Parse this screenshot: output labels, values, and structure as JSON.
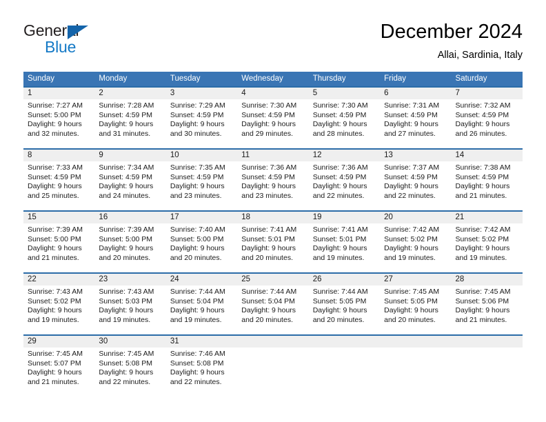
{
  "brand": {
    "name_part1": "General",
    "name_part2": "Blue",
    "accent_color": "#1479c6",
    "triangle_color": "#1464aa"
  },
  "header": {
    "title": "December 2024",
    "subtitle": "Allai, Sardinia, Italy"
  },
  "theme": {
    "header_blue": "#3a75b4",
    "rule_blue": "#2b6ca8",
    "daynum_band": "#efefef"
  },
  "weekdays": [
    "Sunday",
    "Monday",
    "Tuesday",
    "Wednesday",
    "Thursday",
    "Friday",
    "Saturday"
  ],
  "weeks": [
    [
      {
        "day": "1",
        "sunrise": "Sunrise: 7:27 AM",
        "sunset": "Sunset: 5:00 PM",
        "daylight1": "Daylight: 9 hours",
        "daylight2": "and 32 minutes."
      },
      {
        "day": "2",
        "sunrise": "Sunrise: 7:28 AM",
        "sunset": "Sunset: 4:59 PM",
        "daylight1": "Daylight: 9 hours",
        "daylight2": "and 31 minutes."
      },
      {
        "day": "3",
        "sunrise": "Sunrise: 7:29 AM",
        "sunset": "Sunset: 4:59 PM",
        "daylight1": "Daylight: 9 hours",
        "daylight2": "and 30 minutes."
      },
      {
        "day": "4",
        "sunrise": "Sunrise: 7:30 AM",
        "sunset": "Sunset: 4:59 PM",
        "daylight1": "Daylight: 9 hours",
        "daylight2": "and 29 minutes."
      },
      {
        "day": "5",
        "sunrise": "Sunrise: 7:30 AM",
        "sunset": "Sunset: 4:59 PM",
        "daylight1": "Daylight: 9 hours",
        "daylight2": "and 28 minutes."
      },
      {
        "day": "6",
        "sunrise": "Sunrise: 7:31 AM",
        "sunset": "Sunset: 4:59 PM",
        "daylight1": "Daylight: 9 hours",
        "daylight2": "and 27 minutes."
      },
      {
        "day": "7",
        "sunrise": "Sunrise: 7:32 AM",
        "sunset": "Sunset: 4:59 PM",
        "daylight1": "Daylight: 9 hours",
        "daylight2": "and 26 minutes."
      }
    ],
    [
      {
        "day": "8",
        "sunrise": "Sunrise: 7:33 AM",
        "sunset": "Sunset: 4:59 PM",
        "daylight1": "Daylight: 9 hours",
        "daylight2": "and 25 minutes."
      },
      {
        "day": "9",
        "sunrise": "Sunrise: 7:34 AM",
        "sunset": "Sunset: 4:59 PM",
        "daylight1": "Daylight: 9 hours",
        "daylight2": "and 24 minutes."
      },
      {
        "day": "10",
        "sunrise": "Sunrise: 7:35 AM",
        "sunset": "Sunset: 4:59 PM",
        "daylight1": "Daylight: 9 hours",
        "daylight2": "and 23 minutes."
      },
      {
        "day": "11",
        "sunrise": "Sunrise: 7:36 AM",
        "sunset": "Sunset: 4:59 PM",
        "daylight1": "Daylight: 9 hours",
        "daylight2": "and 23 minutes."
      },
      {
        "day": "12",
        "sunrise": "Sunrise: 7:36 AM",
        "sunset": "Sunset: 4:59 PM",
        "daylight1": "Daylight: 9 hours",
        "daylight2": "and 22 minutes."
      },
      {
        "day": "13",
        "sunrise": "Sunrise: 7:37 AM",
        "sunset": "Sunset: 4:59 PM",
        "daylight1": "Daylight: 9 hours",
        "daylight2": "and 22 minutes."
      },
      {
        "day": "14",
        "sunrise": "Sunrise: 7:38 AM",
        "sunset": "Sunset: 4:59 PM",
        "daylight1": "Daylight: 9 hours",
        "daylight2": "and 21 minutes."
      }
    ],
    [
      {
        "day": "15",
        "sunrise": "Sunrise: 7:39 AM",
        "sunset": "Sunset: 5:00 PM",
        "daylight1": "Daylight: 9 hours",
        "daylight2": "and 21 minutes."
      },
      {
        "day": "16",
        "sunrise": "Sunrise: 7:39 AM",
        "sunset": "Sunset: 5:00 PM",
        "daylight1": "Daylight: 9 hours",
        "daylight2": "and 20 minutes."
      },
      {
        "day": "17",
        "sunrise": "Sunrise: 7:40 AM",
        "sunset": "Sunset: 5:00 PM",
        "daylight1": "Daylight: 9 hours",
        "daylight2": "and 20 minutes."
      },
      {
        "day": "18",
        "sunrise": "Sunrise: 7:41 AM",
        "sunset": "Sunset: 5:01 PM",
        "daylight1": "Daylight: 9 hours",
        "daylight2": "and 20 minutes."
      },
      {
        "day": "19",
        "sunrise": "Sunrise: 7:41 AM",
        "sunset": "Sunset: 5:01 PM",
        "daylight1": "Daylight: 9 hours",
        "daylight2": "and 19 minutes."
      },
      {
        "day": "20",
        "sunrise": "Sunrise: 7:42 AM",
        "sunset": "Sunset: 5:02 PM",
        "daylight1": "Daylight: 9 hours",
        "daylight2": "and 19 minutes."
      },
      {
        "day": "21",
        "sunrise": "Sunrise: 7:42 AM",
        "sunset": "Sunset: 5:02 PM",
        "daylight1": "Daylight: 9 hours",
        "daylight2": "and 19 minutes."
      }
    ],
    [
      {
        "day": "22",
        "sunrise": "Sunrise: 7:43 AM",
        "sunset": "Sunset: 5:02 PM",
        "daylight1": "Daylight: 9 hours",
        "daylight2": "and 19 minutes."
      },
      {
        "day": "23",
        "sunrise": "Sunrise: 7:43 AM",
        "sunset": "Sunset: 5:03 PM",
        "daylight1": "Daylight: 9 hours",
        "daylight2": "and 19 minutes."
      },
      {
        "day": "24",
        "sunrise": "Sunrise: 7:44 AM",
        "sunset": "Sunset: 5:04 PM",
        "daylight1": "Daylight: 9 hours",
        "daylight2": "and 19 minutes."
      },
      {
        "day": "25",
        "sunrise": "Sunrise: 7:44 AM",
        "sunset": "Sunset: 5:04 PM",
        "daylight1": "Daylight: 9 hours",
        "daylight2": "and 20 minutes."
      },
      {
        "day": "26",
        "sunrise": "Sunrise: 7:44 AM",
        "sunset": "Sunset: 5:05 PM",
        "daylight1": "Daylight: 9 hours",
        "daylight2": "and 20 minutes."
      },
      {
        "day": "27",
        "sunrise": "Sunrise: 7:45 AM",
        "sunset": "Sunset: 5:05 PM",
        "daylight1": "Daylight: 9 hours",
        "daylight2": "and 20 minutes."
      },
      {
        "day": "28",
        "sunrise": "Sunrise: 7:45 AM",
        "sunset": "Sunset: 5:06 PM",
        "daylight1": "Daylight: 9 hours",
        "daylight2": "and 21 minutes."
      }
    ],
    [
      {
        "day": "29",
        "sunrise": "Sunrise: 7:45 AM",
        "sunset": "Sunset: 5:07 PM",
        "daylight1": "Daylight: 9 hours",
        "daylight2": "and 21 minutes."
      },
      {
        "day": "30",
        "sunrise": "Sunrise: 7:45 AM",
        "sunset": "Sunset: 5:08 PM",
        "daylight1": "Daylight: 9 hours",
        "daylight2": "and 22 minutes."
      },
      {
        "day": "31",
        "sunrise": "Sunrise: 7:46 AM",
        "sunset": "Sunset: 5:08 PM",
        "daylight1": "Daylight: 9 hours",
        "daylight2": "and 22 minutes."
      },
      {
        "day": "",
        "sunrise": "",
        "sunset": "",
        "daylight1": "",
        "daylight2": ""
      },
      {
        "day": "",
        "sunrise": "",
        "sunset": "",
        "daylight1": "",
        "daylight2": ""
      },
      {
        "day": "",
        "sunrise": "",
        "sunset": "",
        "daylight1": "",
        "daylight2": ""
      },
      {
        "day": "",
        "sunrise": "",
        "sunset": "",
        "daylight1": "",
        "daylight2": ""
      }
    ]
  ]
}
